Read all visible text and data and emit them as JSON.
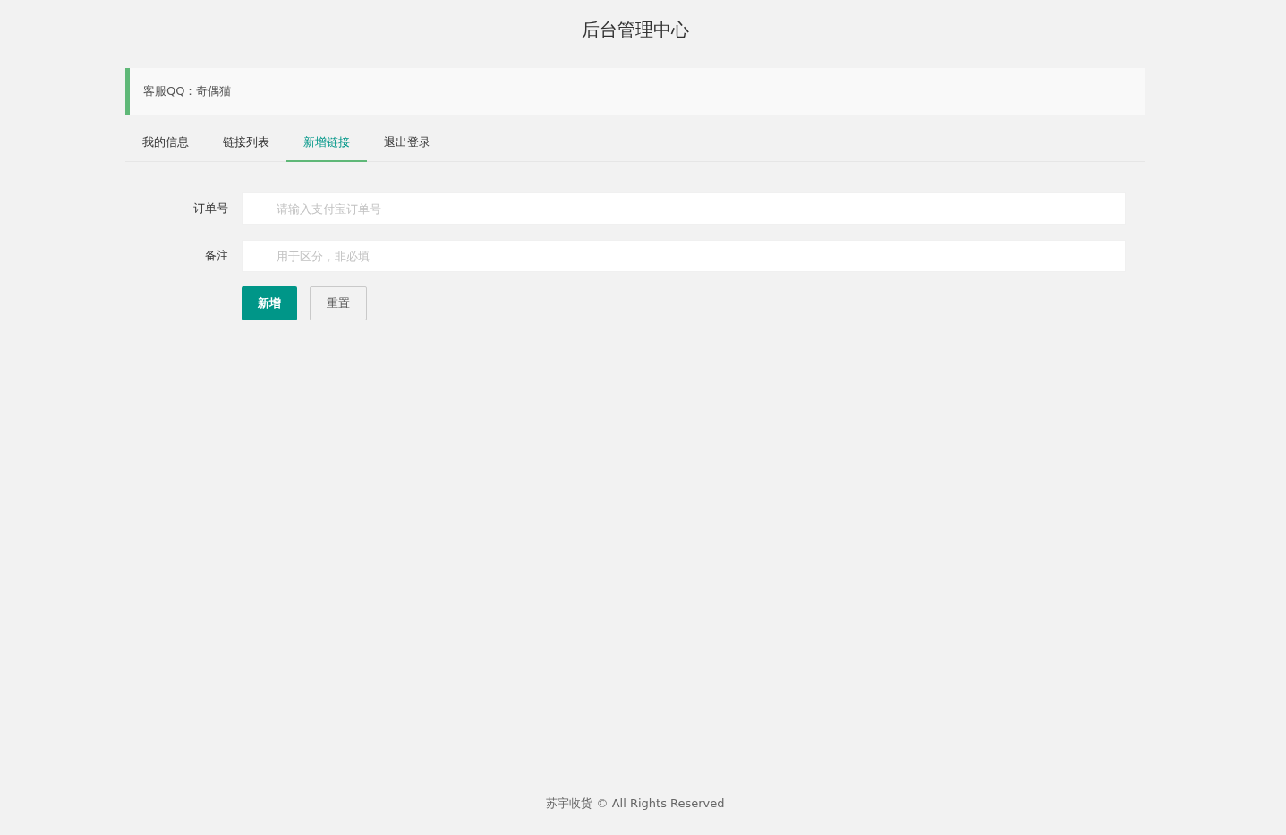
{
  "header": {
    "title": "后台管理中心"
  },
  "notice": {
    "text": "客服QQ：奇偶猫"
  },
  "tabs": [
    {
      "label": "我的信息",
      "selected": false
    },
    {
      "label": "链接列表",
      "selected": false
    },
    {
      "label": "新增链接",
      "selected": true
    },
    {
      "label": "退出登录",
      "selected": false
    }
  ],
  "form": {
    "fields": [
      {
        "label": "订单号",
        "placeholder": "请输入支付宝订单号"
      },
      {
        "label": "备注",
        "placeholder": "用于区分，非必填"
      }
    ],
    "buttons": [
      {
        "label": "新增",
        "kind": "primary"
      },
      {
        "label": "重置",
        "kind": "default"
      }
    ]
  },
  "footer": {
    "text": "苏宇收货 © All Rights Reserved"
  }
}
